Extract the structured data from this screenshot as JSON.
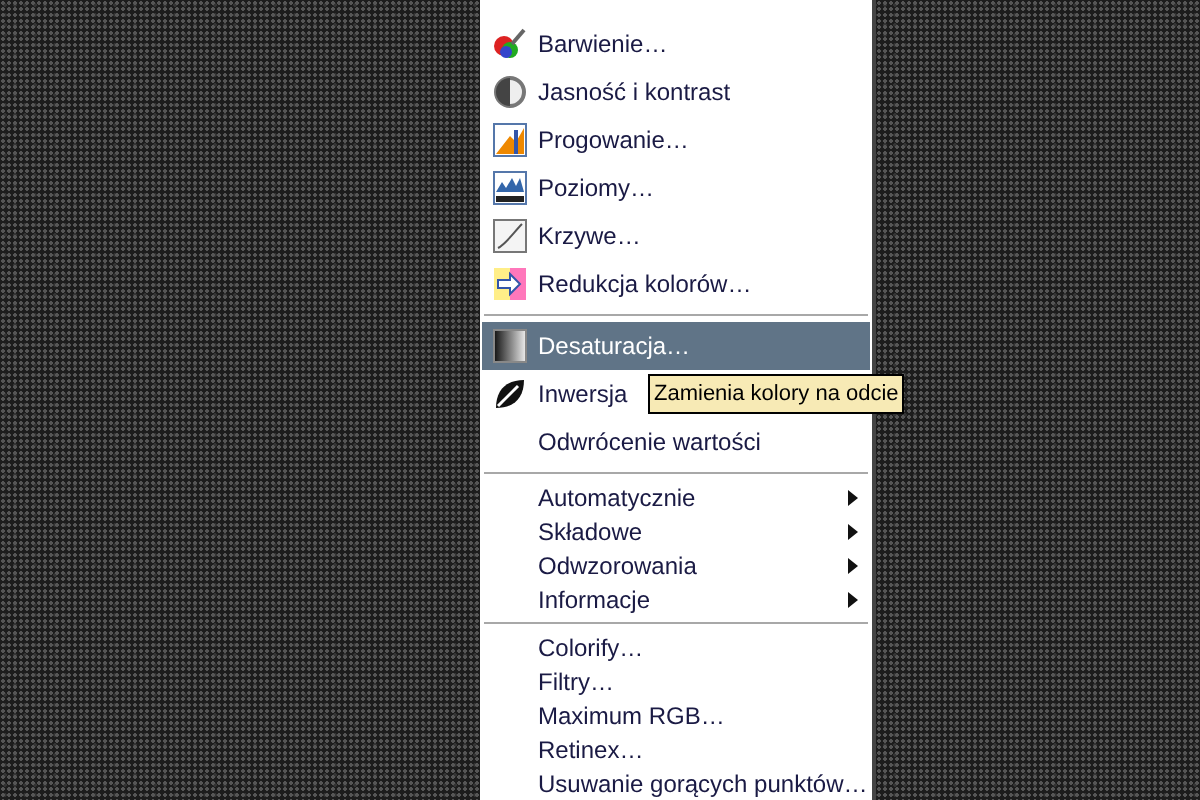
{
  "menu": {
    "sections": [
      {
        "items": [
          {
            "label": "Barwienie…",
            "kind": "icon",
            "selected": false
          },
          {
            "label": "Jasność i kontrast",
            "kind": "icon",
            "selected": false
          },
          {
            "label": "Progowanie…",
            "kind": "icon",
            "selected": false
          },
          {
            "label": "Poziomy…",
            "kind": "icon",
            "selected": false
          },
          {
            "label": "Krzywe…",
            "kind": "icon",
            "selected": false
          },
          {
            "label": "Redukcja kolorów…",
            "kind": "icon",
            "selected": false
          }
        ]
      },
      {
        "items": [
          {
            "label": "Desaturacja…",
            "kind": "icon",
            "selected": true
          },
          {
            "label": "Inwersja",
            "kind": "icon",
            "selected": false
          },
          {
            "label": "Odwrócenie wartości",
            "kind": "plain",
            "selected": false
          }
        ]
      },
      {
        "items": [
          {
            "label": "Automatycznie",
            "kind": "submenu",
            "selected": false
          },
          {
            "label": "Składowe",
            "kind": "submenu",
            "selected": false
          },
          {
            "label": "Odwzorowania",
            "kind": "submenu",
            "selected": false
          },
          {
            "label": "Informacje",
            "kind": "submenu",
            "selected": false
          }
        ]
      },
      {
        "items": [
          {
            "label": "Colorify…",
            "kind": "plain",
            "selected": false
          },
          {
            "label": "Filtry…",
            "kind": "plain",
            "selected": false
          },
          {
            "label": "Maximum RGB…",
            "kind": "plain",
            "selected": false
          },
          {
            "label": "Retinex…",
            "kind": "plain",
            "selected": false
          },
          {
            "label": "Usuwanie gorących punktów…",
            "kind": "plain",
            "selected": false
          }
        ]
      }
    ]
  },
  "tooltip": {
    "text": "Zamienia kolory na odcie"
  }
}
